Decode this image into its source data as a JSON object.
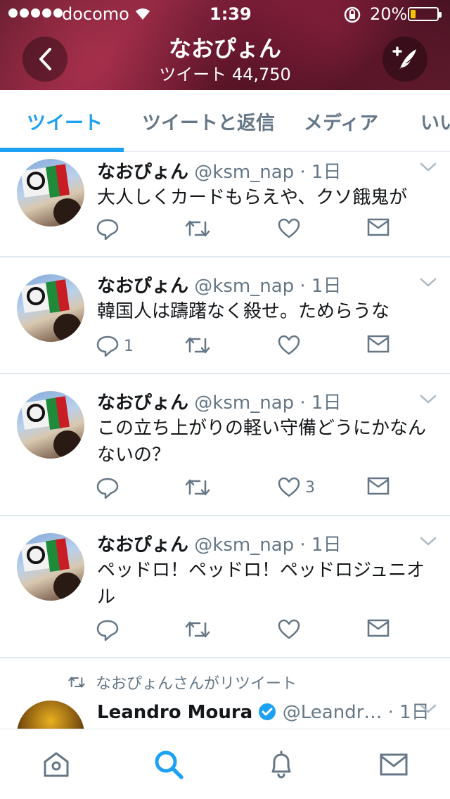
{
  "status_bar": {
    "carrier": "docomo",
    "time": "1:39",
    "battery_percent": "20%",
    "battery_level": 0.2,
    "battery_color": "#f5c400"
  },
  "header": {
    "title": "なおぴょん",
    "subtitle": "ツイート 44,750",
    "back_icon": "chevron-left-icon",
    "compose_icon": "compose-quill-icon"
  },
  "tabs": [
    {
      "label": "ツイート",
      "active": true
    },
    {
      "label": "ツイートと返信",
      "active": false
    },
    {
      "label": "メディア",
      "active": false
    },
    {
      "label": "いい",
      "active": false
    }
  ],
  "accent_color": "#1da1f2",
  "tweets": [
    {
      "name": "なおぴょん",
      "meta": "@ksm_nap · 1日",
      "text": "大人しくカードもらえや、クソ餓鬼が",
      "reply_count": "",
      "like_count": ""
    },
    {
      "name": "なおぴょん",
      "meta": "@ksm_nap · 1日",
      "text": "韓国人は躊躇なく殺せ。ためらうな",
      "reply_count": "1",
      "like_count": ""
    },
    {
      "name": "なおぴょん",
      "meta": "@ksm_nap · 1日",
      "text": "この立ち上がりの軽い守備どうにかなんないの？",
      "reply_count": "",
      "like_count": "3"
    },
    {
      "name": "なおぴょん",
      "meta": "@ksm_nap · 1日",
      "text": "ペッドロ！ペッドロ！ペッドロジュニオル",
      "reply_count": "",
      "like_count": ""
    }
  ],
  "retweet": {
    "retweet_label": "なおぴょんさんがリツイート",
    "name": "Leandro Moura",
    "verified": true,
    "meta": "@Leandr… · 1日"
  },
  "bottom_nav": [
    "home-icon",
    "search-icon",
    "notifications-bell-icon",
    "messages-envelope-icon"
  ]
}
